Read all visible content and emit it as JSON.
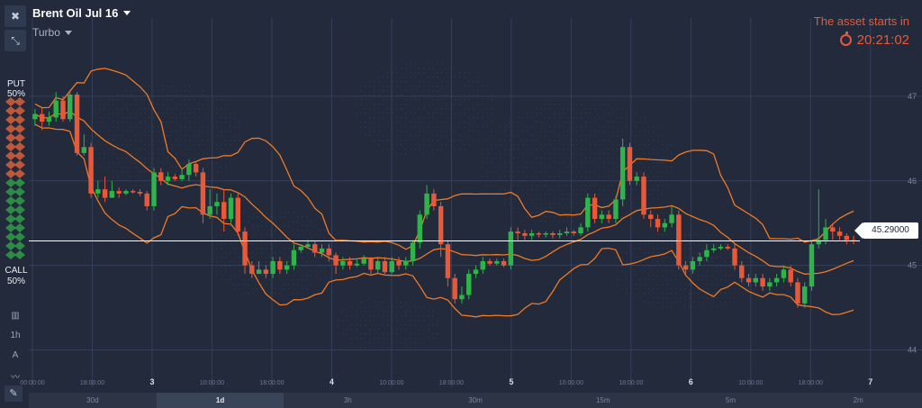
{
  "header": {
    "asset_name": "Brent Oil Jul 16",
    "mode": "Turbo",
    "starts_label": "The asset starts in",
    "timer": "20:21:02"
  },
  "side": {
    "put_label": "PUT",
    "put_pct": "50%",
    "call_label": "CALL",
    "call_pct": "50%",
    "tool_1h": "1h",
    "tool_a": "A"
  },
  "current_price": "45.29000",
  "timeframes": [
    {
      "label": "30d",
      "active": false
    },
    {
      "label": "1d",
      "active": true
    },
    {
      "label": "3h",
      "active": false
    },
    {
      "label": "30m",
      "active": false
    },
    {
      "label": "15m",
      "active": false
    },
    {
      "label": "5m",
      "active": false
    },
    {
      "label": "2m",
      "active": false
    }
  ],
  "colors": {
    "background": "#222a3b",
    "grid": "#34405a",
    "candle_up": "#2fb34a",
    "candle_down": "#e8593a",
    "band": "#f07a25",
    "timer": "#e8593a"
  },
  "chart_data": {
    "type": "candlestick",
    "y_ticks": [
      "47",
      "46",
      "45",
      "44"
    ],
    "x_ticks": [
      "00:00:00",
      "18:00:00",
      "3",
      "10:00:00",
      "18:00:00",
      "4",
      "10:00:00",
      "18:00:00",
      "5",
      "10:00:00",
      "18:00:00",
      "6",
      "10:00:00",
      "18:00:00",
      "7"
    ],
    "ylim": [
      43.75,
      47.5
    ],
    "last_price": 45.29,
    "candles": [
      [
        46.73,
        46.79,
        46.85,
        46.65
      ],
      [
        46.79,
        46.7,
        46.86,
        46.6
      ],
      [
        46.7,
        46.75,
        46.82,
        46.65
      ],
      [
        46.75,
        46.95,
        47.05,
        46.7
      ],
      [
        46.95,
        46.73,
        47.0,
        46.7
      ],
      [
        46.73,
        47.02,
        47.05,
        46.7
      ],
      [
        47.02,
        46.33,
        47.05,
        46.3
      ],
      [
        46.33,
        46.4,
        46.55,
        46.3
      ],
      [
        46.4,
        45.85,
        46.45,
        45.8
      ],
      [
        45.85,
        45.9,
        46.0,
        45.8
      ],
      [
        45.9,
        45.8,
        46.05,
        45.75
      ],
      [
        45.8,
        45.88,
        46.0,
        45.8
      ],
      [
        45.88,
        45.85,
        45.92,
        45.8
      ],
      [
        45.85,
        45.88,
        45.9,
        45.83
      ],
      [
        45.88,
        45.87,
        45.9,
        45.85
      ],
      [
        45.87,
        45.85,
        45.9,
        45.82
      ],
      [
        45.85,
        45.7,
        45.88,
        45.65
      ],
      [
        45.7,
        46.1,
        46.15,
        45.65
      ],
      [
        46.1,
        46.0,
        46.15,
        45.95
      ],
      [
        46.0,
        46.05,
        46.1,
        45.95
      ],
      [
        46.05,
        46.02,
        46.08,
        46.0
      ],
      [
        46.02,
        46.07,
        46.15,
        46.0
      ],
      [
        46.07,
        46.2,
        46.25,
        46.0
      ],
      [
        46.2,
        46.1,
        46.22,
        46.05
      ],
      [
        46.1,
        45.6,
        46.15,
        45.5
      ],
      [
        45.6,
        45.7,
        45.9,
        45.55
      ],
      [
        45.7,
        45.75,
        45.85,
        45.6
      ],
      [
        45.75,
        45.55,
        45.9,
        45.4
      ],
      [
        45.55,
        45.8,
        45.85,
        45.5
      ],
      [
        45.8,
        45.4,
        45.85,
        45.35
      ],
      [
        45.4,
        45.0,
        45.45,
        44.9
      ],
      [
        45.0,
        44.9,
        45.05,
        44.85
      ],
      [
        44.9,
        44.95,
        45.05,
        44.9
      ],
      [
        44.95,
        44.9,
        45.0,
        44.85
      ],
      [
        44.9,
        45.05,
        45.1,
        44.85
      ],
      [
        45.05,
        44.95,
        45.1,
        44.9
      ],
      [
        44.95,
        45.0,
        45.05,
        44.9
      ],
      [
        45.0,
        45.18,
        45.25,
        44.95
      ],
      [
        45.18,
        45.22,
        45.25,
        45.15
      ],
      [
        45.22,
        45.25,
        45.3,
        45.2
      ],
      [
        45.25,
        45.15,
        45.28,
        45.1
      ],
      [
        45.15,
        45.2,
        45.25,
        45.1
      ],
      [
        45.2,
        45.12,
        45.25,
        45.05
      ],
      [
        45.12,
        45.0,
        45.15,
        44.9
      ],
      [
        45.0,
        45.05,
        45.1,
        44.95
      ],
      [
        45.05,
        45.0,
        45.1,
        44.95
      ],
      [
        45.0,
        45.02,
        45.08,
        44.98
      ],
      [
        45.02,
        45.08,
        45.12,
        45.0
      ],
      [
        45.08,
        44.95,
        45.1,
        44.9
      ],
      [
        44.95,
        45.05,
        45.1,
        44.9
      ],
      [
        45.05,
        44.92,
        45.1,
        44.9
      ],
      [
        44.92,
        45.05,
        45.1,
        44.9
      ],
      [
        45.05,
        45.0,
        45.1,
        44.95
      ],
      [
        45.0,
        45.05,
        45.1,
        44.95
      ],
      [
        45.05,
        45.27,
        45.3,
        45.0
      ],
      [
        45.27,
        45.6,
        45.65,
        45.2
      ],
      [
        45.6,
        45.85,
        45.95,
        45.55
      ],
      [
        45.85,
        45.7,
        45.9,
        45.65
      ],
      [
        45.7,
        45.25,
        45.75,
        45.1
      ],
      [
        45.25,
        44.85,
        45.3,
        44.75
      ],
      [
        44.85,
        44.6,
        44.9,
        44.55
      ],
      [
        44.6,
        44.65,
        44.75,
        44.55
      ],
      [
        44.65,
        44.9,
        44.95,
        44.6
      ],
      [
        44.9,
        44.95,
        45.0,
        44.85
      ],
      [
        44.95,
        45.05,
        45.1,
        44.9
      ],
      [
        45.05,
        45.02,
        45.08,
        45.0
      ],
      [
        45.02,
        45.05,
        45.08,
        45.0
      ],
      [
        45.05,
        45.0,
        45.08,
        44.98
      ],
      [
        45.0,
        45.4,
        45.45,
        44.95
      ],
      [
        45.4,
        45.38,
        45.45,
        45.3
      ],
      [
        45.38,
        45.35,
        45.42,
        45.3
      ],
      [
        45.35,
        45.38,
        45.42,
        45.3
      ],
      [
        45.38,
        45.37,
        45.4,
        45.33
      ],
      [
        45.37,
        45.38,
        45.4,
        45.33
      ],
      [
        45.38,
        45.36,
        45.4,
        45.32
      ],
      [
        45.36,
        45.38,
        45.42,
        45.32
      ],
      [
        45.38,
        45.4,
        45.45,
        45.35
      ],
      [
        45.4,
        45.38,
        45.42,
        45.35
      ],
      [
        45.38,
        45.45,
        45.5,
        45.35
      ],
      [
        45.45,
        45.8,
        45.85,
        45.4
      ],
      [
        45.8,
        45.55,
        45.85,
        45.5
      ],
      [
        45.55,
        45.6,
        45.65,
        45.5
      ],
      [
        45.6,
        45.55,
        45.65,
        45.5
      ],
      [
        45.55,
        45.78,
        45.82,
        45.5
      ],
      [
        45.78,
        46.4,
        46.5,
        45.7
      ],
      [
        46.4,
        46.0,
        46.45,
        45.95
      ],
      [
        46.0,
        46.05,
        46.1,
        45.95
      ],
      [
        46.05,
        45.6,
        46.1,
        45.55
      ],
      [
        45.6,
        45.55,
        45.65,
        45.45
      ],
      [
        45.55,
        45.45,
        45.6,
        45.4
      ],
      [
        45.45,
        45.5,
        45.55,
        45.4
      ],
      [
        45.5,
        45.6,
        45.7,
        45.45
      ],
      [
        45.6,
        45.0,
        45.65,
        44.95
      ],
      [
        45.0,
        44.95,
        45.05,
        44.9
      ],
      [
        44.95,
        45.05,
        45.1,
        44.9
      ],
      [
        45.05,
        45.1,
        45.15,
        45.0
      ],
      [
        45.1,
        45.18,
        45.25,
        45.05
      ],
      [
        45.18,
        45.2,
        45.25,
        45.15
      ],
      [
        45.2,
        45.22,
        45.25,
        45.18
      ],
      [
        45.22,
        45.2,
        45.25,
        45.18
      ],
      [
        45.2,
        45.0,
        45.25,
        44.95
      ],
      [
        45.0,
        44.85,
        45.05,
        44.8
      ],
      [
        44.85,
        44.8,
        44.9,
        44.75
      ],
      [
        44.8,
        44.85,
        44.9,
        44.75
      ],
      [
        44.85,
        44.75,
        44.9,
        44.7
      ],
      [
        44.75,
        44.8,
        44.85,
        44.7
      ],
      [
        44.8,
        44.85,
        44.9,
        44.75
      ],
      [
        44.85,
        44.95,
        45.0,
        44.8
      ],
      [
        44.95,
        44.8,
        45.0,
        44.75
      ],
      [
        44.8,
        44.55,
        44.85,
        44.5
      ],
      [
        44.55,
        44.75,
        44.8,
        44.5
      ],
      [
        44.75,
        45.25,
        45.3,
        44.7
      ],
      [
        45.25,
        45.3,
        45.9,
        45.2
      ],
      [
        45.3,
        45.45,
        45.55,
        45.25
      ],
      [
        45.45,
        45.4,
        45.5,
        45.3
      ],
      [
        45.4,
        45.35,
        45.45,
        45.3
      ],
      [
        45.35,
        45.3,
        45.38,
        45.25
      ],
      [
        45.3,
        45.29,
        45.35,
        45.25
      ]
    ]
  }
}
